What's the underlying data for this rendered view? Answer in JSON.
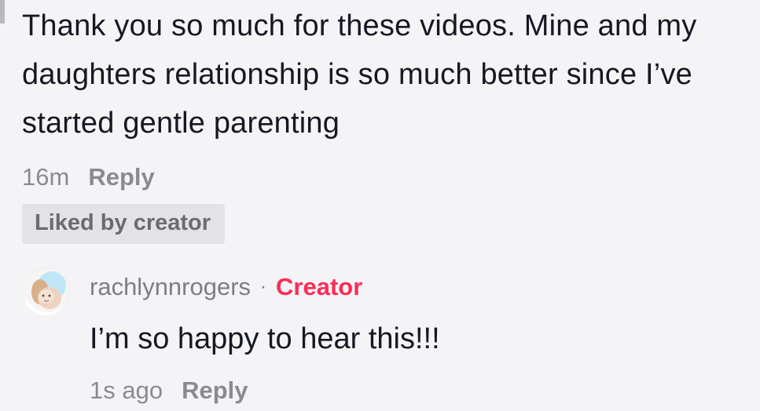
{
  "comment": {
    "text": "Thank you so much for these videos. Mine and my daughters relationship is so much better since I’ve started gentle parenting",
    "time": "16m",
    "reply_label": "Reply",
    "liked_badge": "Liked by creator"
  },
  "reply": {
    "username": "rachlynnrogers",
    "separator": "·",
    "role": "Creator",
    "text": "I’m so happy to hear this!!!",
    "time": "1s ago",
    "reply_label": "Reply"
  },
  "colors": {
    "background": "#f4f4f6",
    "text": "#161823",
    "muted": "#8a8b91",
    "badge_bg": "#e3e3e6",
    "creator": "#fe2c55"
  },
  "icons": {
    "avatar": "profile-avatar-icon"
  }
}
